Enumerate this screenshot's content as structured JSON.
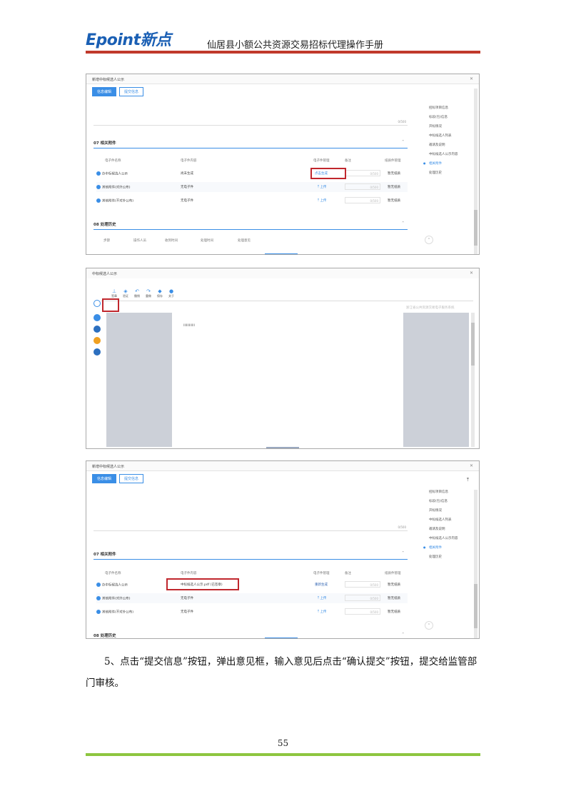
{
  "header": {
    "logo": "Epoint新点",
    "title": "仙居县小额公共资源交易招标代理操作手册"
  },
  "shot1": {
    "window_title": "新增中标候选人公示",
    "tabs": [
      "信息编辑",
      "提交信息"
    ],
    "textarea_count": "0/500",
    "section7": "07  相关附件",
    "section8": "08  处理历史",
    "columns": [
      "电子件名称",
      "电子件内容",
      "电子件管理",
      "备注",
      "纸质件管理"
    ],
    "rows": [
      {
        "name": "办中标候选人公示",
        "content": "尚未生成",
        "action": "点击生成",
        "note": "0/500",
        "paper": "暂无纸质"
      },
      {
        "name": "其他附件(对外公布)",
        "content": "无电子件",
        "action": "上传",
        "note": "0/500",
        "paper": "暂无纸质"
      },
      {
        "name": "其他附件(不对外公布)",
        "content": "无电子件",
        "action": "上传",
        "note": "0/500",
        "paper": "暂无纸质"
      }
    ],
    "history_columns": [
      "步骤",
      "操作人员",
      "收到时间",
      "处理时间",
      "处理意见"
    ],
    "nav": [
      "招标项目信息",
      "标段(包)信息",
      "开标情况",
      "中标候选人列表",
      "邀请及说明",
      "中标候选人公示内容",
      "相关附件",
      "处理历史"
    ],
    "nav_active": 6
  },
  "shot2": {
    "window_title": "中标候选人公示",
    "tools": [
      "签章",
      "验证",
      "撤销",
      "重做",
      "保存",
      "关于"
    ],
    "watermark": "浙江省公共资源交易电子服务系统",
    "page_text": "IIIIIIIIIIII"
  },
  "shot3": {
    "window_title": "新增中标候选人公示",
    "tabs": [
      "信息编辑",
      "提交信息"
    ],
    "textarea_count": "0/500",
    "section7": "07  相关附件",
    "section8": "08  处理历史",
    "columns": [
      "电子件名称",
      "电子件内容",
      "电子件管理",
      "备注",
      "纸质件管理"
    ],
    "rows": [
      {
        "name": "办中标候选人公示",
        "content": "中标候选人公示.pdf (已签章)",
        "action": "重新生成",
        "note": "0/500",
        "paper": "暂无纸质"
      },
      {
        "name": "其他附件(对外公布)",
        "content": "无电子件",
        "action": "上传",
        "note": "0/500",
        "paper": "暂无纸质"
      },
      {
        "name": "其他附件(不对外公布)",
        "content": "无电子件",
        "action": "上传",
        "note": "0/500",
        "paper": "暂无纸质"
      }
    ],
    "nav": [
      "招标项目信息",
      "标段(包)信息",
      "开标情况",
      "中标候选人列表",
      "邀请及说明",
      "中标候选人公示内容",
      "相关附件",
      "处理历史"
    ],
    "nav_active": 6
  },
  "paragraph": "5、点击“提交信息”按钮，弹出意见框，输入意见后点击“确认提交”按钮，提交给监管部门审核。",
  "page_number": "55"
}
